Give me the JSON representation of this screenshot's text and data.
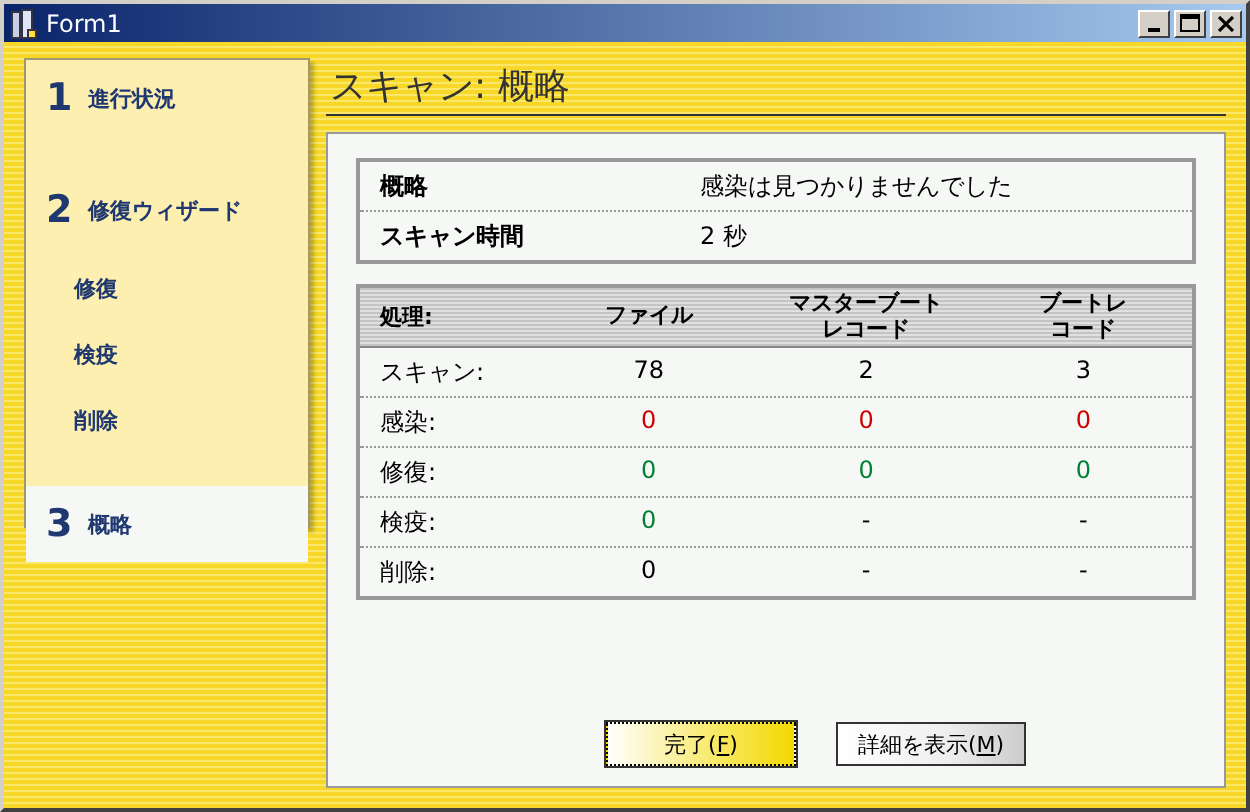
{
  "window": {
    "title": "Form1"
  },
  "steps": [
    {
      "number": "1",
      "label": "進行状況",
      "selected": false
    },
    {
      "number": "2",
      "label": "修復ウィザード",
      "selected": false,
      "children": [
        {
          "label": "修復"
        },
        {
          "label": "検疫"
        },
        {
          "label": "削除"
        }
      ]
    },
    {
      "number": "3",
      "label": "概略",
      "selected": true
    }
  ],
  "heading": "スキャン:  概略",
  "summary": [
    {
      "label": "概略",
      "value": "感染は見つかりませんでした"
    },
    {
      "label": "スキャン時間",
      "value": "2 秒"
    }
  ],
  "table": {
    "columns": [
      "処理:",
      "ファイル",
      "マスターブートレコード",
      "ブートレコード"
    ],
    "rows": [
      {
        "cells": [
          {
            "text": "スキャン:"
          },
          {
            "text": "78"
          },
          {
            "text": "2"
          },
          {
            "text": "3"
          }
        ]
      },
      {
        "cells": [
          {
            "text": "感染:"
          },
          {
            "text": "0",
            "color": "#cc0000"
          },
          {
            "text": "0",
            "color": "#cc0000"
          },
          {
            "text": "0",
            "color": "#cc0000"
          }
        ]
      },
      {
        "cells": [
          {
            "text": "修復:"
          },
          {
            "text": "0",
            "color": "#008033"
          },
          {
            "text": "0",
            "color": "#008033"
          },
          {
            "text": "0",
            "color": "#008033"
          }
        ]
      },
      {
        "cells": [
          {
            "text": "検疫:"
          },
          {
            "text": "0",
            "color": "#008033"
          },
          {
            "text": "-"
          },
          {
            "text": "-"
          }
        ]
      },
      {
        "cells": [
          {
            "text": "削除:"
          },
          {
            "text": "0"
          },
          {
            "text": "-"
          },
          {
            "text": "-"
          }
        ]
      }
    ]
  },
  "buttons": [
    {
      "before": "完了(",
      "key": "F",
      "after": ")",
      "default": true
    },
    {
      "before": "詳細を表示(",
      "key": "M",
      "after": ")",
      "default": false
    }
  ]
}
